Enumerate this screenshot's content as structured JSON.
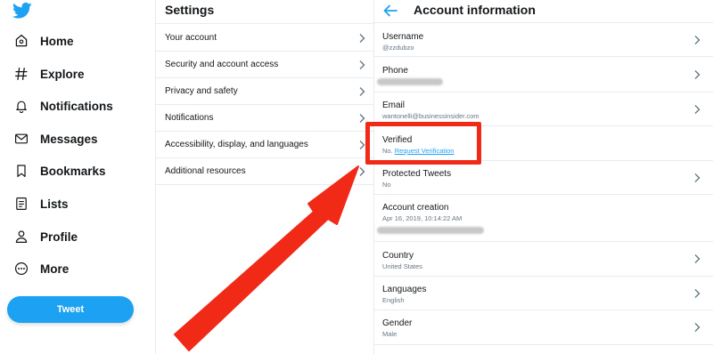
{
  "sidebar": {
    "logo_icon": "twitter-bird-icon",
    "items": [
      {
        "label": "Home",
        "icon": "home-icon"
      },
      {
        "label": "Explore",
        "icon": "hashtag-icon"
      },
      {
        "label": "Notifications",
        "icon": "bell-icon"
      },
      {
        "label": "Messages",
        "icon": "envelope-icon"
      },
      {
        "label": "Bookmarks",
        "icon": "bookmark-icon"
      },
      {
        "label": "Lists",
        "icon": "list-icon"
      },
      {
        "label": "Profile",
        "icon": "person-icon"
      },
      {
        "label": "More",
        "icon": "more-dots-icon"
      }
    ],
    "tweet_button": "Tweet"
  },
  "settings": {
    "title": "Settings",
    "items": [
      {
        "label": "Your account"
      },
      {
        "label": "Security and account access"
      },
      {
        "label": "Privacy and safety"
      },
      {
        "label": "Notifications"
      },
      {
        "label": "Accessibility, display, and languages"
      },
      {
        "label": "Additional resources"
      }
    ]
  },
  "account": {
    "title": "Account information",
    "rows": [
      {
        "label": "Username",
        "value": "@zzdubzo"
      },
      {
        "label": "Phone",
        "value": ""
      },
      {
        "label": "Email",
        "value": "wantonelli@businessinsider.com"
      },
      {
        "label": "Verified",
        "value": "No.",
        "link": "Request Verification"
      },
      {
        "label": "Protected Tweets",
        "value": "No"
      },
      {
        "label": "Account creation",
        "value": "Apr 16, 2019, 10:14:22 AM"
      },
      {
        "label": "Country",
        "value": "United States"
      },
      {
        "label": "Languages",
        "value": "English"
      },
      {
        "label": "Gender",
        "value": "Male"
      }
    ]
  },
  "colors": {
    "accent": "#1da1f2",
    "annotation": "#f12a18",
    "divider": "#e6ecf0"
  }
}
